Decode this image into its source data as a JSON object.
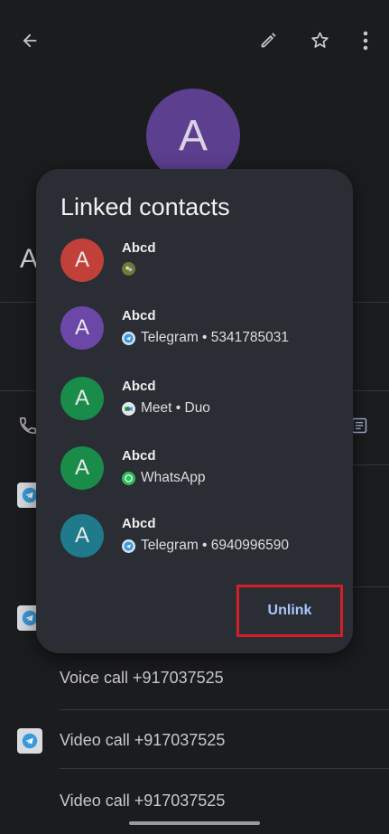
{
  "header": {
    "back_icon": "arrow-left-icon",
    "edit_icon": "pencil-icon",
    "favorite_icon": "star-outline-icon",
    "more_icon": "more-vert-icon"
  },
  "contact": {
    "avatar_letter": "A",
    "name_initial": "A"
  },
  "background_rows": [
    {
      "label": "Voice call +917037525"
    },
    {
      "label": "Video call +917037525"
    },
    {
      "label": "Video call +917037525"
    }
  ],
  "dialog": {
    "title": "Linked contacts",
    "contacts": [
      {
        "letter": "A",
        "name": "Abcd",
        "source": "",
        "color": "#c1413a"
      },
      {
        "letter": "A",
        "name": "Abcd",
        "source": "Telegram • 5341785031",
        "color": "#6b47a8"
      },
      {
        "letter": "A",
        "name": "Abcd",
        "source": "Meet • Duo",
        "color": "#198c4a"
      },
      {
        "letter": "A",
        "name": "Abcd",
        "source": "WhatsApp",
        "color": "#198c4a"
      },
      {
        "letter": "A",
        "name": "Abcd",
        "source": "Telegram • 6940996590",
        "color": "#1f7a8c"
      }
    ],
    "unlink_label": "Unlink"
  },
  "colors": {
    "background": "#1b1c1e",
    "dialog": "#2a2d33",
    "accent": "#a8c7fa",
    "highlight_box": "#d1202a"
  }
}
